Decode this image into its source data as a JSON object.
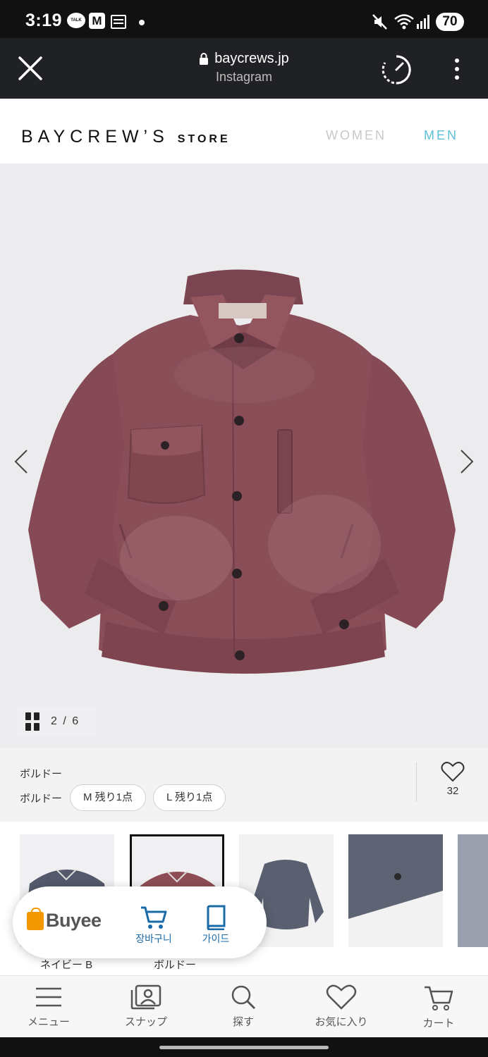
{
  "status_bar": {
    "time": "3:19",
    "talk_label": "TALK",
    "m_label": "M",
    "battery": "70"
  },
  "browser": {
    "url": "baycrews.jp",
    "source": "Instagram"
  },
  "site": {
    "logo_main": "BAYCREW’S",
    "logo_sub": "STORE",
    "nav_women": "WOMEN",
    "nav_men": "MEN"
  },
  "gallery": {
    "counter": "2 / 6"
  },
  "product": {
    "color_name": "ボルドー",
    "color_row_label": "ボルドー",
    "sizes": [
      "M 残り1点",
      "L 残り1点"
    ],
    "favorite_count": "32"
  },
  "thumbnails": {
    "captions": [
      "ネイビー B",
      "ボルドー"
    ]
  },
  "buyee": {
    "brand": "Buyee",
    "cart_label": "장바구니",
    "guide_label": "가이드"
  },
  "bottom_nav": {
    "menu": "メニュー",
    "snap": "スナップ",
    "search": "探す",
    "favorites": "お気に入り",
    "cart": "カート"
  },
  "colors": {
    "accent_men": "#5cc0d8",
    "buyee_orange": "#f39800",
    "buyee_blue": "#1a6aa8",
    "jacket": "#8a4e58"
  }
}
